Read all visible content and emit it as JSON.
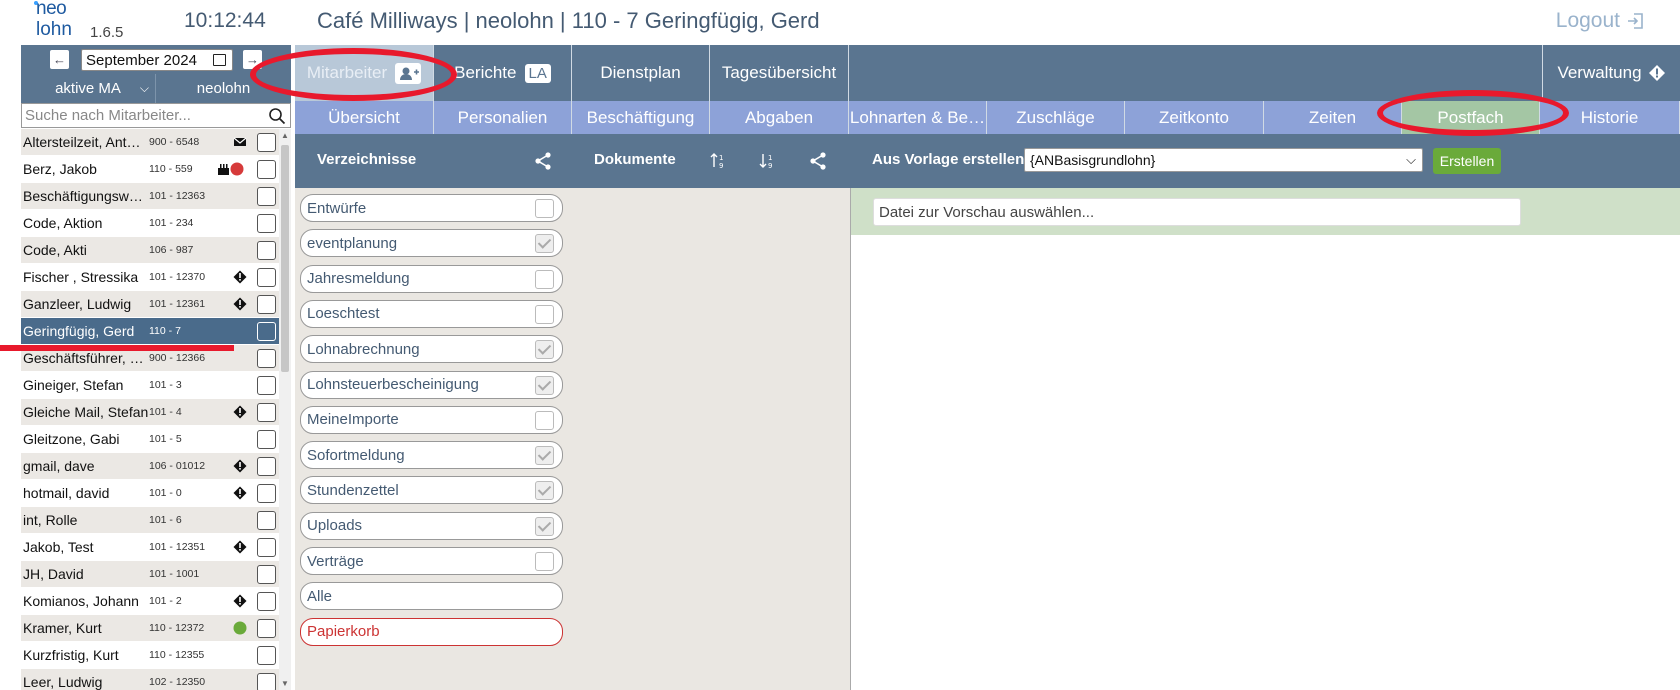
{
  "header": {
    "logo_top": "neo",
    "logo_bottom": "lohn",
    "version": "1.6.5",
    "time": "10:12:44",
    "title": "Café Milliways | neolohn | 110 - 7 Geringfügig, Gerd",
    "logout": "Logout"
  },
  "left": {
    "date": "September 2024",
    "prev_icon": "arrow-left-icon",
    "next_icon": "arrow-right-icon",
    "filter_active": "aktive MA",
    "filter_scope": "neolohn",
    "search_placeholder": "Suche nach Mitarbeiter...",
    "employees": [
      {
        "name": "Altersteilzeit, Ant…",
        "nr": "900 - 6548",
        "icon": "envelope-icon"
      },
      {
        "name": "Berz, Jakob",
        "nr": "110 - 559",
        "icon": "cake-icon"
      },
      {
        "name": "Beschäftigungsw…",
        "nr": "101 - 12363",
        "icon": ""
      },
      {
        "name": "Code, Aktion",
        "nr": "101 - 234",
        "icon": ""
      },
      {
        "name": "Code, Akti",
        "nr": "106 - 987",
        "icon": ""
      },
      {
        "name": "Fischer , Stressika",
        "nr": "101 - 12370",
        "icon": "warning-icon"
      },
      {
        "name": "Ganzleer, Ludwig",
        "nr": "101 - 12361",
        "icon": "warning-icon"
      },
      {
        "name": "Geringfügig, Gerd",
        "nr": "110 - 7",
        "icon": ""
      },
      {
        "name": "Geschäftsführer, …",
        "nr": "900 - 12366",
        "icon": ""
      },
      {
        "name": "Gineiger, Stefan",
        "nr": "101 - 3",
        "icon": ""
      },
      {
        "name": "Gleiche Mail, Stefan",
        "nr": "101 - 4",
        "icon": "warning-icon"
      },
      {
        "name": "Gleitzone, Gabi",
        "nr": "101 - 5",
        "icon": ""
      },
      {
        "name": "gmail, dave",
        "nr": "106 - 01012",
        "icon": "warning-icon"
      },
      {
        "name": "hotmail, david",
        "nr": "101 - 0",
        "icon": "warning-icon"
      },
      {
        "name": "int, Rolle",
        "nr": "101 - 6",
        "icon": ""
      },
      {
        "name": "Jakob, Test",
        "nr": "101 - 12351",
        "icon": "warning-icon"
      },
      {
        "name": "JH, David",
        "nr": "101 - 1001",
        "icon": ""
      },
      {
        "name": "Komianos, Johann",
        "nr": "101 - 2",
        "icon": "warning-icon"
      },
      {
        "name": "Kramer, Kurt",
        "nr": "110 - 12372",
        "icon": "green-dot-icon"
      },
      {
        "name": "Kurzfristig, Kurt",
        "nr": "110 - 12355",
        "icon": ""
      },
      {
        "name": "Leer, Ludwig",
        "nr": "102 - 12350",
        "icon": ""
      }
    ]
  },
  "nav": {
    "main_tabs": [
      "Mitarbeiter",
      "Berichte",
      "Dienstplan",
      "Tagesübersicht",
      "Verwaltung"
    ],
    "la_badge": "LA",
    "sub_tabs": [
      "Übersicht",
      "Personalien",
      "Beschäftigung",
      "Abgaben",
      "Lohnarten & Be…",
      "Zuschläge",
      "Zeitkonto",
      "Zeiten",
      "Postfach",
      "Historie"
    ]
  },
  "toolbar": {
    "verzeichnisse": "Verzeichnisse",
    "dokumente": "Dokumente",
    "vorlage_label": "Aus Vorlage erstellen:",
    "vorlage_value": "{ANBasisgrundlohn}",
    "create": "Erstellen"
  },
  "folders": [
    {
      "name": "Entwürfe",
      "checked": false
    },
    {
      "name": "eventplanung",
      "checked": true
    },
    {
      "name": "Jahresmeldung",
      "checked": false
    },
    {
      "name": "Loeschtest",
      "checked": false
    },
    {
      "name": "Lohnabrechnung",
      "checked": true
    },
    {
      "name": "Lohnsteuerbescheinigung",
      "checked": true
    },
    {
      "name": "MeineImporte",
      "checked": false
    },
    {
      "name": "Sofortmeldung",
      "checked": true
    },
    {
      "name": "Stundenzettel",
      "checked": true
    },
    {
      "name": "Uploads",
      "checked": true
    },
    {
      "name": "Verträge",
      "checked": false
    },
    {
      "name": "Alle",
      "checked": null
    },
    {
      "name": "Papierkorb",
      "checked": null
    }
  ],
  "preview": {
    "placeholder": "Datei zur Vorschau auswählen..."
  },
  "colors": {
    "nav_bg": "#5a7590",
    "subnav_bg": "#8da2d8",
    "active_sub": "#a4c6a4",
    "annotation": "#e8192c"
  }
}
